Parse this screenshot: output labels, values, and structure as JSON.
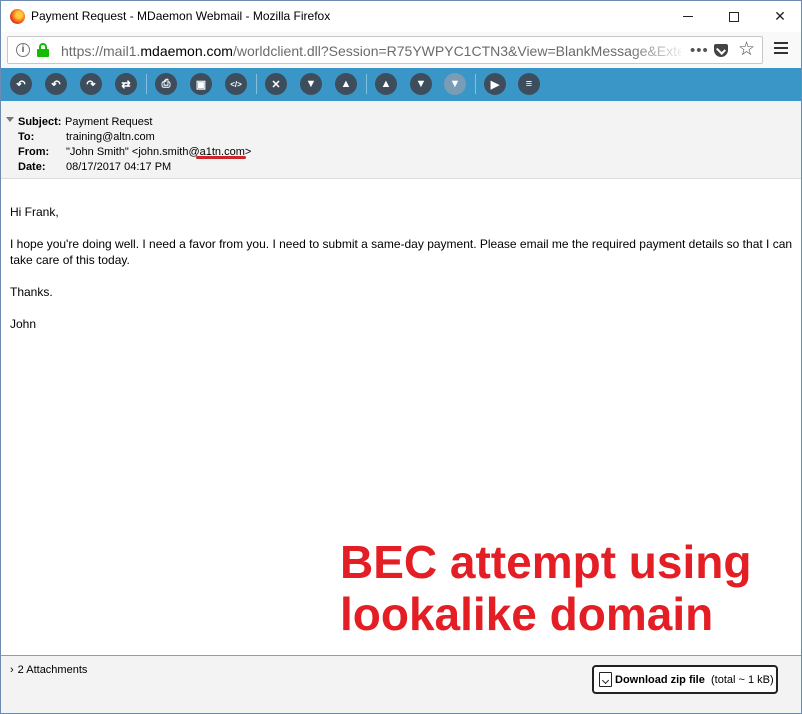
{
  "window": {
    "title": "Payment Request - MDaemon Webmail - Mozilla Firefox"
  },
  "navbar": {
    "url_prefix": "https://mail1.",
    "url_host": "mdaemon.com",
    "url_rest": "/worldclient.dll?Session=R75YWPYC1CTN3&View=BlankMessage&Exte",
    "more_icon": "•••",
    "star_icon": "☆"
  },
  "toolbar": {
    "buttons": [
      {
        "name": "reply-icon",
        "glyph": "↶"
      },
      {
        "name": "reply-all-icon",
        "glyph": "↶"
      },
      {
        "name": "forward-icon",
        "glyph": "↷"
      },
      {
        "name": "redirect-icon",
        "glyph": "⇄"
      },
      {
        "name": "print-icon",
        "glyph": "⎙"
      },
      {
        "name": "save-icon",
        "glyph": "▣"
      },
      {
        "name": "view-source-icon",
        "glyph": "</>"
      },
      {
        "name": "delete-icon",
        "glyph": "✕"
      },
      {
        "name": "thumbs-down-icon",
        "glyph": "▼"
      },
      {
        "name": "thumbs-up-icon",
        "glyph": "▲"
      },
      {
        "name": "previous-message-icon",
        "glyph": "▲"
      },
      {
        "name": "next-message-icon",
        "glyph": "▼"
      },
      {
        "name": "flag-icon",
        "glyph": "▼"
      },
      {
        "name": "play-icon",
        "glyph": "▶"
      },
      {
        "name": "more-menu-icon",
        "glyph": "≡"
      }
    ]
  },
  "message": {
    "subject_label": "Subject:",
    "subject": "Payment Request",
    "to_label": "To:",
    "to": "training@altn.com",
    "from_label": "From:",
    "from": "\"John Smith\" <john.smith@a1tn.com>",
    "date_label": "Date:",
    "date": "08/17/2017 04:17 PM",
    "body": [
      "Hi Frank,",
      "I hope you're doing well. I need a favor from you. I need to submit a same-day payment. Please email me the required payment details so that I can take care of this today.",
      "Thanks.",
      "John"
    ]
  },
  "annotation": {
    "line1": "BEC attempt using",
    "line2": "lookalike domain",
    "color": "#e31e24"
  },
  "footer": {
    "attachments_label": "2 Attachments",
    "download_label": "Download zip file",
    "download_size": "(total ~ 1 kB)"
  },
  "colors": {
    "toolbar": "#3b96c8",
    "toolbar_button": "#3d4d5c",
    "lock": "#12bc00"
  }
}
